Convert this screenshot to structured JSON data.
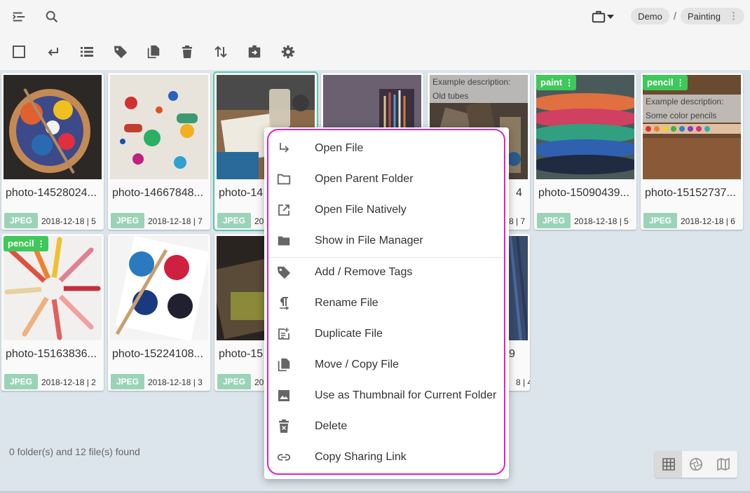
{
  "breadcrumb": {
    "root": "Demo",
    "separator": "/",
    "current": "Painting"
  },
  "toolbar": [
    "select-all",
    "return",
    "list",
    "tag",
    "copy",
    "delete",
    "sort",
    "move",
    "settings"
  ],
  "files": [
    {
      "name": "photo-14528024...",
      "type": "JPEG",
      "meta": "2018-12-18 | 5"
    },
    {
      "name": "photo-14667848...",
      "type": "JPEG",
      "meta": "2018-12-18 | 7"
    },
    {
      "name": "photo-14...",
      "type": "JPEG",
      "meta": "20"
    },
    {
      "name": "",
      "type": "",
      "meta": ""
    },
    {
      "name": "photo-...4...",
      "type": "",
      "meta": "8 | 7",
      "description": "Example description: Old tubes"
    },
    {
      "name": "photo-15090439...",
      "type": "JPEG",
      "meta": "2018-12-18 | 5",
      "tag": "paint"
    },
    {
      "name": "photo-15152737...",
      "type": "JPEG",
      "meta": "2018-12-18 | 6",
      "tag": "pencil",
      "description": "Example description: Some color pencils"
    },
    {
      "name": "photo-15163836...",
      "type": "JPEG",
      "meta": "2018-12-18 | 2",
      "tag": "pencil"
    },
    {
      "name": "photo-15224108...",
      "type": "JPEG",
      "meta": "2018-12-18 | 3"
    },
    {
      "name": "photo-15",
      "type": "JPEG",
      "meta": "20"
    },
    {
      "name": "...9...",
      "type": "",
      "meta": "8 | 4"
    }
  ],
  "card_texts": {
    "c0": {
      "name": "photo-14528024...",
      "type": "JPEG",
      "meta": "2018-12-18 | 5"
    },
    "c1": {
      "name": "photo-14667848...",
      "type": "JPEG",
      "meta": "2018-12-18 | 7"
    },
    "c2": {
      "name": "photo-14",
      "type": "JPEG",
      "meta": "20"
    },
    "c4": {
      "name": "4",
      "meta": "8 | 7",
      "desc1": "Example description:",
      "desc2": "Old tubes"
    },
    "c5": {
      "name": "photo-15090439...",
      "type": "JPEG",
      "meta": "2018-12-18 | 5",
      "tag": "paint"
    },
    "c6": {
      "name": "photo-15152737...",
      "type": "JPEG",
      "meta": "2018-12-18 | 6",
      "tag": "pencil",
      "desc1": "Example description:",
      "desc2": "Some color pencils"
    },
    "c7": {
      "name": "photo-15163836...",
      "type": "JPEG",
      "meta": "2018-12-18 | 2",
      "tag": "pencil"
    },
    "c8": {
      "name": "photo-15224108...",
      "type": "JPEG",
      "meta": "2018-12-18 | 3"
    },
    "c9": {
      "name": "photo-15",
      "type": "JPEG",
      "meta": "20"
    },
    "c10": {
      "name": "9",
      "meta": "8 | 4"
    }
  },
  "status": "0 folder(s) and 12 file(s) found",
  "context_menu": [
    {
      "label": "Open File",
      "icon": "open-file-icon"
    },
    {
      "label": "Open Parent Folder",
      "icon": "folder-outline-icon"
    },
    {
      "label": "Open File Natively",
      "icon": "open-external-icon"
    },
    {
      "label": "Show in File Manager",
      "icon": "folder-icon"
    },
    {
      "label": "Add / Remove Tags",
      "icon": "tag-icon"
    },
    {
      "label": "Rename File",
      "icon": "rename-icon"
    },
    {
      "label": "Duplicate File",
      "icon": "duplicate-icon"
    },
    {
      "label": "Move / Copy File",
      "icon": "copy-icon"
    },
    {
      "label": "Use as Thumbnail for Current Folder",
      "icon": "image-icon"
    },
    {
      "label": "Delete",
      "icon": "delete-icon"
    },
    {
      "label": "Copy Sharing Link",
      "icon": "link-icon"
    }
  ],
  "view_modes": [
    "grid",
    "aperture",
    "map"
  ],
  "colors": {
    "accent": "#e020c8",
    "tag": "#3ec95a",
    "filetype": "#9bd3b8",
    "selected": "#5ac8a8"
  }
}
